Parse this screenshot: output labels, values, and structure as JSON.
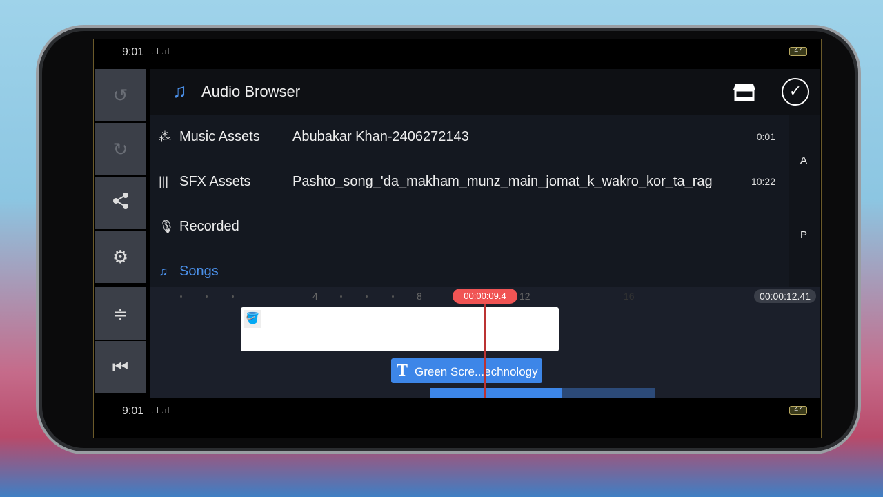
{
  "status": {
    "time": "9:01",
    "signal": ".ıl .ıl",
    "battery": "47"
  },
  "sidebar": {
    "undo": "undo-icon",
    "redo": "redo-icon",
    "share": "share-icon",
    "settings": "gear-icon",
    "split": "split-icon",
    "skip_start": "skip-start-icon"
  },
  "header": {
    "title": "Audio Browser",
    "accent": "#4a8fe8"
  },
  "categories": [
    {
      "label": "Music Assets",
      "icon": "music-assets-icon"
    },
    {
      "label": "SFX Assets",
      "icon": "waveform-icon"
    },
    {
      "label": "Recorded",
      "icon": "microphone-icon"
    },
    {
      "label": "Songs",
      "icon": "music-note-icon",
      "active": true
    }
  ],
  "files": [
    {
      "name": "Abubakar Khan-2406272143",
      "duration": "0:01"
    },
    {
      "name": "Pashto_song_'da_makham_munz_main_jomat_k_wakro_kor_ta_rag",
      "duration": "10:22"
    }
  ],
  "index": [
    "A",
    "P"
  ],
  "timeline": {
    "ticks": [
      "4",
      "8",
      "12",
      "16"
    ],
    "playhead": "00:00:09.4",
    "total": "00:00:12.41",
    "text_clip": "Green Scre...echnology"
  }
}
